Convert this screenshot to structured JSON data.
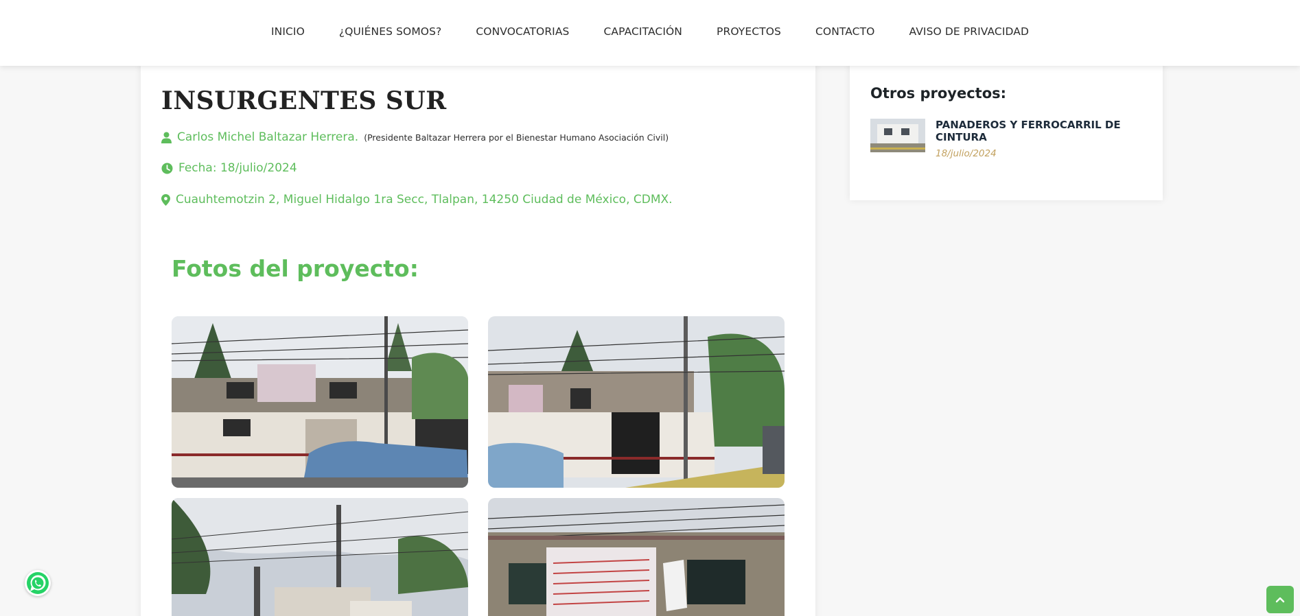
{
  "nav": {
    "items": [
      "INICIO",
      "¿QUIÉNES SOMOS?",
      "CONVOCATORIAS",
      "CAPACITACIÓN",
      "PROYECTOS",
      "CONTACTO",
      "AVISO DE PRIVACIDAD"
    ]
  },
  "project": {
    "title": "INSURGENTES SUR",
    "author": "Carlos Michel Baltazar Herrera.",
    "author_role": "(Presidente Baltazar Herrera por el Bienestar Humano Asociación Civil)",
    "date": "Fecha: 18/julio/2024",
    "address": "Cuauhtemotzin 2, Miguel Hidalgo 1ra Secc, Tlalpan, 14250 Ciudad de México, CDMX."
  },
  "photos": {
    "heading": "Fotos del proyecto:"
  },
  "sidebar": {
    "title": "Otros proyectos:",
    "item_title": "PANADEROS Y FERROCARRIL DE CINTURA",
    "item_date": "18/julio/2024"
  },
  "colors": {
    "accent": "#5ebd5c",
    "date_gold": "#c2a15f",
    "heading_dark": "#222222"
  },
  "icons": {
    "author": "user-icon",
    "date": "clock-icon",
    "address": "map-pin-icon",
    "whatsapp": "whatsapp-icon",
    "scroll": "chevron-up-icon"
  }
}
